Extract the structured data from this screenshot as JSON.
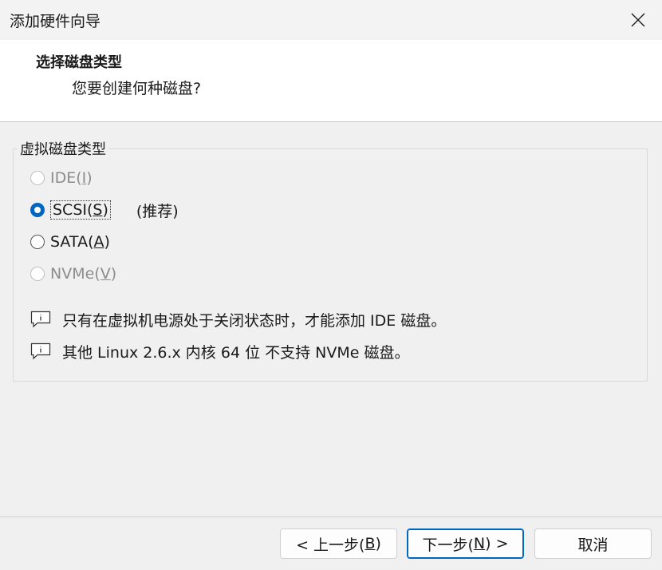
{
  "window": {
    "title": "添加硬件向导"
  },
  "header": {
    "title": "选择磁盘类型",
    "subtitle": "您要创建何种磁盘?"
  },
  "group": {
    "label": "虚拟磁盘类型"
  },
  "options": {
    "ide": {
      "label": "IDE(",
      "key": "I",
      "close": ")",
      "state": "disabled"
    },
    "scsi": {
      "label": "SCSI(",
      "key": "S",
      "close": ")",
      "recommend": "(推荐)",
      "state": "selected"
    },
    "sata": {
      "label": "SATA(",
      "key": "A",
      "close": ")",
      "state": "unselected"
    },
    "nvme": {
      "label": "NVMe(",
      "key": "V",
      "close": ")",
      "state": "disabled"
    }
  },
  "notes": {
    "n1": {
      "icon": "info-comment-icon",
      "text": "只有在虚拟机电源处于关闭状态时，才能添加 IDE 磁盘。"
    },
    "n2": {
      "icon": "info-comment-icon",
      "text": "其他 Linux 2.6.x 内核 64 位 不支持 NVMe 磁盘。"
    }
  },
  "buttons": {
    "back": {
      "prefix": "< 上一步(",
      "key": "B",
      "suffix": ")"
    },
    "next": {
      "prefix": "下一步(",
      "key": "N",
      "suffix": ") >"
    },
    "cancel": {
      "label": "取消"
    }
  },
  "colors": {
    "accent": "#0067c0",
    "disabled_text": "#8c8c8c"
  }
}
